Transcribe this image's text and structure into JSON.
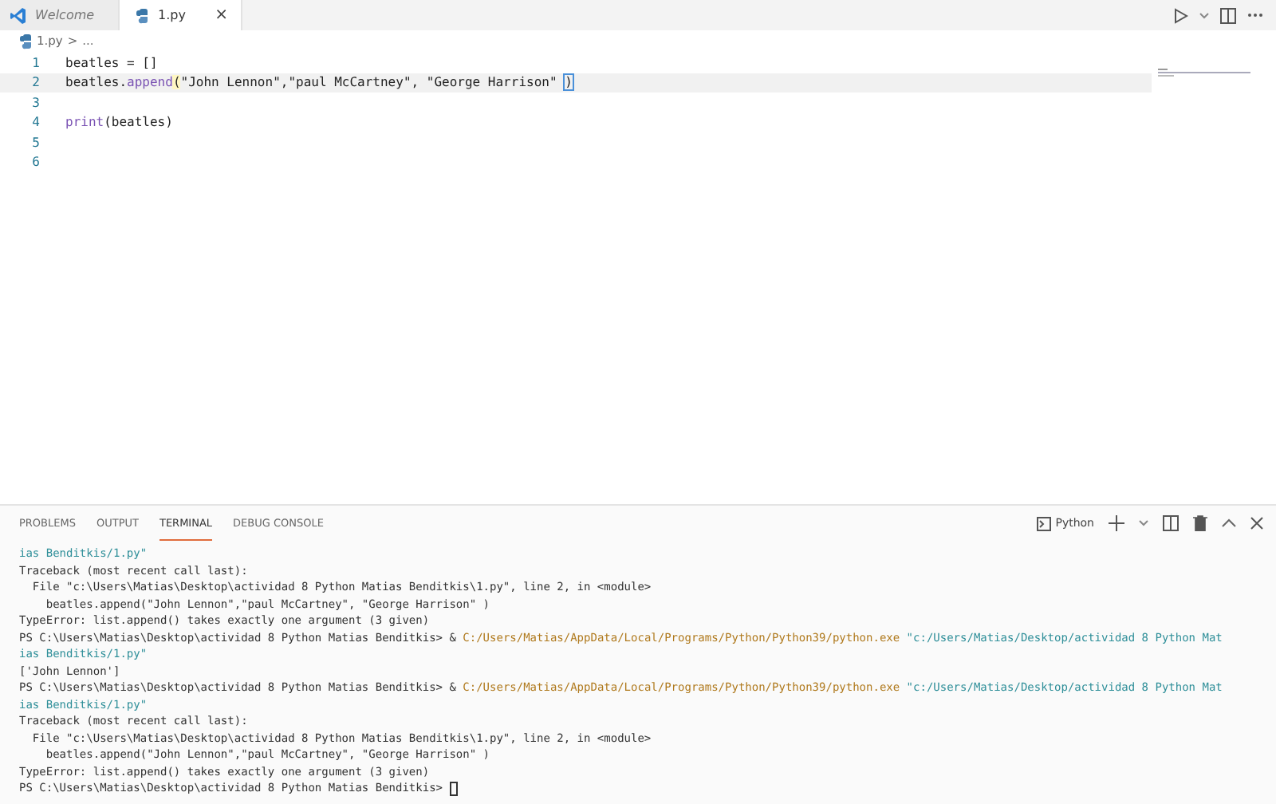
{
  "tabs": [
    {
      "label": "Welcome",
      "kind": "welcome",
      "selected": false,
      "closable": false
    },
    {
      "label": "1.py",
      "kind": "python",
      "selected": true,
      "closable": true
    }
  ],
  "tab_close": "×",
  "breadcrumb": {
    "file": "1.py",
    "separator": ">",
    "rest": "..."
  },
  "editor": {
    "lines": [
      {
        "number": "1",
        "tokens": [
          {
            "kind": "plain",
            "text": "beatles = []"
          }
        ]
      },
      {
        "number": "2",
        "current": true,
        "tokens": [
          {
            "kind": "plain",
            "text": "beatles."
          },
          {
            "kind": "func",
            "text": "append"
          },
          {
            "kind": "bracket",
            "text": "("
          },
          {
            "kind": "plain",
            "text": "\"John Lennon\",\"paul McCartney\", \"George Harrison\" "
          },
          {
            "kind": "bracket-box",
            "text": ")"
          }
        ]
      },
      {
        "number": "3"
      },
      {
        "number": "4",
        "tokens": [
          {
            "kind": "func",
            "text": "print"
          },
          {
            "kind": "plain",
            "text": "(beatles)"
          }
        ]
      },
      {
        "number": "5"
      },
      {
        "number": "6"
      }
    ]
  },
  "panel": {
    "tabs": [
      {
        "label": "PROBLEMS",
        "selected": false
      },
      {
        "label": "OUTPUT",
        "selected": false
      },
      {
        "label": "TERMINAL",
        "selected": true
      },
      {
        "label": "DEBUG CONSOLE",
        "selected": false
      }
    ],
    "shell_label": "Python",
    "terminal_lines": [
      [
        {
          "kind": "string",
          "text": "ias Benditkis/1.py\""
        }
      ],
      [
        {
          "kind": "plain",
          "text": "Traceback (most recent call last):"
        }
      ],
      [
        {
          "kind": "plain",
          "text": "  File \"c:\\Users\\Matias\\Desktop\\actividad 8 Python Matias Benditkis\\1.py\", line 2, in <module>"
        }
      ],
      [
        {
          "kind": "plain",
          "text": "    beatles.append(\"John Lennon\",\"paul McCartney\", \"George Harrison\" )"
        }
      ],
      [
        {
          "kind": "plain",
          "text": "TypeError: list.append() takes exactly one argument (3 given)"
        }
      ],
      [
        {
          "kind": "plain",
          "text": "PS C:\\Users\\Matias\\Desktop\\actividad 8 Python Matias Benditkis> & "
        },
        {
          "kind": "path",
          "text": "C:/Users/Matias/AppData/Local/Programs/Python/Python39/python.exe"
        },
        {
          "kind": "string",
          "text": " \"c:/Users/Matias/Desktop/actividad 8 Python Mat"
        }
      ],
      [
        {
          "kind": "string",
          "text": "ias Benditkis/1.py\""
        }
      ],
      [
        {
          "kind": "plain",
          "text": "['John Lennon']"
        }
      ],
      [
        {
          "kind": "plain",
          "text": "PS C:\\Users\\Matias\\Desktop\\actividad 8 Python Matias Benditkis> & "
        },
        {
          "kind": "path",
          "text": "C:/Users/Matias/AppData/Local/Programs/Python/Python39/python.exe"
        },
        {
          "kind": "string",
          "text": " \"c:/Users/Matias/Desktop/actividad 8 Python Mat"
        }
      ],
      [
        {
          "kind": "string",
          "text": "ias Benditkis/1.py\""
        }
      ],
      [
        {
          "kind": "plain",
          "text": "Traceback (most recent call last):"
        }
      ],
      [
        {
          "kind": "plain",
          "text": "  File \"c:\\Users\\Matias\\Desktop\\actividad 8 Python Matias Benditkis\\1.py\", line 2, in <module>"
        }
      ],
      [
        {
          "kind": "plain",
          "text": "    beatles.append(\"John Lennon\",\"paul McCartney\", \"George Harrison\" )"
        }
      ],
      [
        {
          "kind": "plain",
          "text": "TypeError: list.append() takes exactly one argument (3 given)"
        }
      ],
      [
        {
          "kind": "plain",
          "text": "PS C:\\Users\\Matias\\Desktop\\actividad 8 Python Matias Benditkis> "
        },
        {
          "kind": "cursor"
        }
      ]
    ]
  }
}
